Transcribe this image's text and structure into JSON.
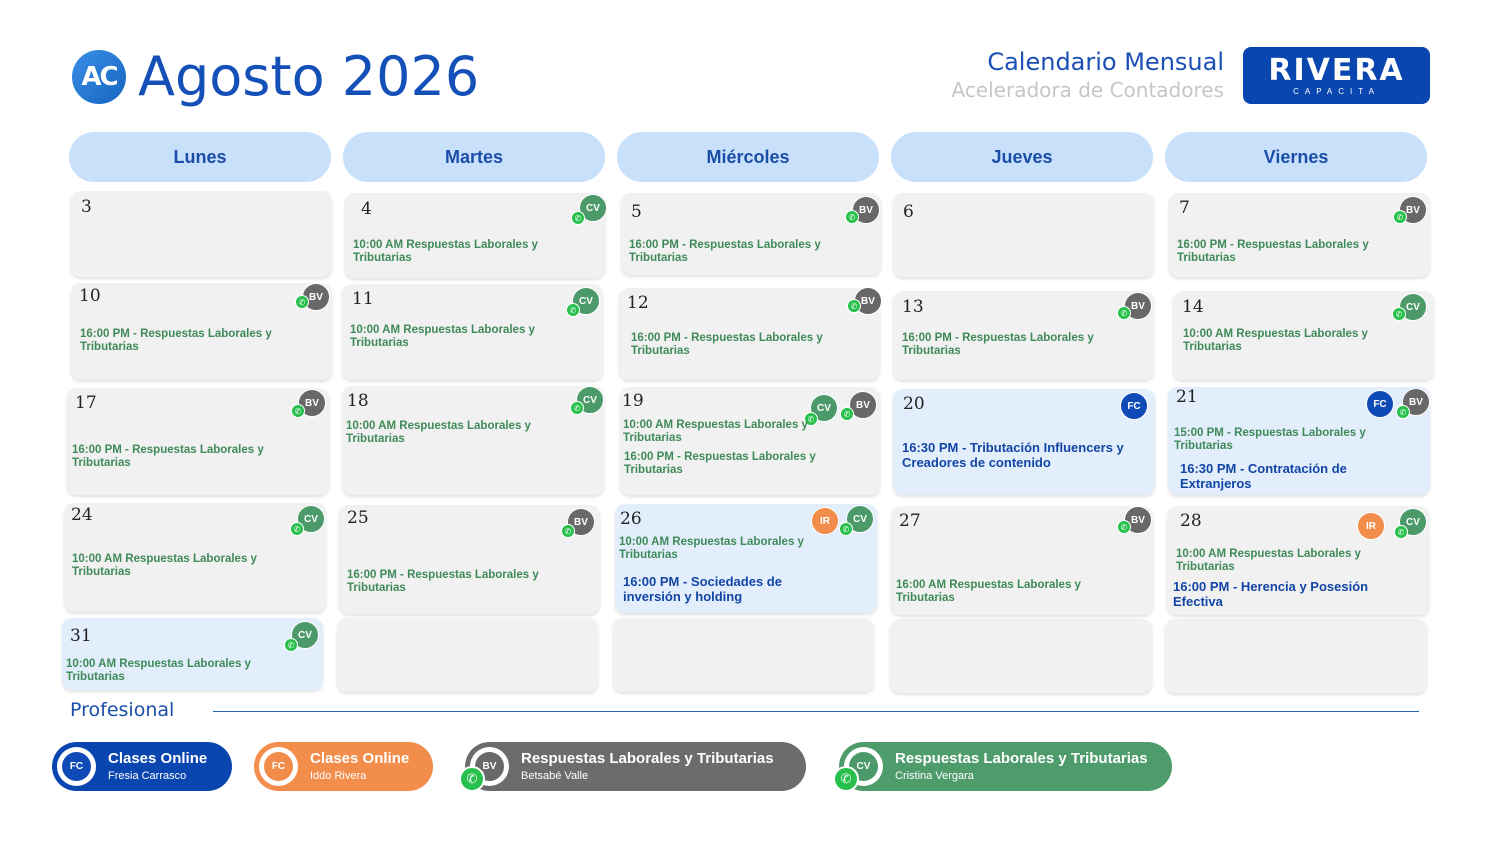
{
  "header": {
    "logo_text": "AC",
    "title": "Agosto 2026",
    "cal_title": "Calendario Mensual",
    "cal_subtitle": "Aceleradora de Contadores",
    "brand_name": "RIVERA",
    "brand_sub": "CAPACITA"
  },
  "days": [
    "Lunes",
    "Martes",
    "Miércoles",
    "Jueves",
    "Viernes"
  ],
  "cells": {
    "d3": "3",
    "d4": "4",
    "d5": "5",
    "d6": "6",
    "d7": "7",
    "d10": "10",
    "d11": "11",
    "d12": "12",
    "d13": "13",
    "d14": "14",
    "d17": "17",
    "d18": "18",
    "d19": "19",
    "d20": "20",
    "d21": "21",
    "d24": "24",
    "d25": "25",
    "d26": "26",
    "d27": "27",
    "d28": "28",
    "d31": "31"
  },
  "events": {
    "e4": "10:00 AM Respuestas Laborales y Tributarias",
    "e5": "16:00 PM - Respuestas Laborales y Tributarias",
    "e7": "16:00 PM - Respuestas Laborales y Tributarias",
    "e10": "16:00 PM - Respuestas Laborales y Tributarias",
    "e11": "10:00 AM Respuestas Laborales y Tributarias",
    "e12": "16:00 PM - Respuestas Laborales y Tributarias",
    "e13": "16:00 PM - Respuestas Laborales y Tributarias",
    "e14": "10:00 AM Respuestas Laborales y Tributarias",
    "e17": "16:00 PM - Respuestas Laborales y Tributarias",
    "e18": "10:00 AM Respuestas Laborales y Tributarias",
    "e19a": "10:00 AM Respuestas Laborales y Tributarias",
    "e19b": "16:00 PM - Respuestas Laborales y Tributarias",
    "e20": "16:30 PM - Tributación Influencers y Creadores de contenido",
    "e21a": "15:00 PM - Respuestas Laborales y Tributarias",
    "e21b": "16:30 PM - Contratación de Extranjeros",
    "e24": "10:00 AM Respuestas Laborales y Tributarias",
    "e25": "16:00 PM - Respuestas Laborales y Tributarias",
    "e26a": "10:00 AM Respuestas Laborales y Tributarias",
    "e26b": "16:00 PM - Sociedades de inversión y holding",
    "e27": "16:00 AM Respuestas Laborales y Tributarias",
    "e28a": "10:00 AM Respuestas Laborales y Tributarias",
    "e28b": "16:00 PM - Herencia y Posesión Efectiva",
    "e31": "10:00 AM Respuestas Laborales y Tributarias"
  },
  "badges": {
    "bv": "BV",
    "cv": "CV",
    "fc": "FC",
    "ir": "IR"
  },
  "legend": {
    "section_label": "Profesional",
    "items": [
      {
        "badge": "FC",
        "title": "Clases Online",
        "person": "Fresia Carrasco",
        "color": "#0a46b0"
      },
      {
        "badge": "FC",
        "title": "Clases Online",
        "person": "Iddo Rivera",
        "color": "#f28d4b"
      },
      {
        "badge": "BV",
        "title": "Respuestas Laborales y Tributarias",
        "person": "Betsabé Valle",
        "color": "#6c6c6c"
      },
      {
        "badge": "CV",
        "title": "Respuestas Laborales y Tributarias",
        "person": "Cristina Vergara",
        "color": "#4e9b6b"
      }
    ]
  },
  "colors": {
    "primary": "#1450b8",
    "header_bg": "#c9e0fa",
    "cell_bg": "#f1f1f1",
    "green_text": "#3f8a59",
    "whatsapp": "#28c04c"
  }
}
